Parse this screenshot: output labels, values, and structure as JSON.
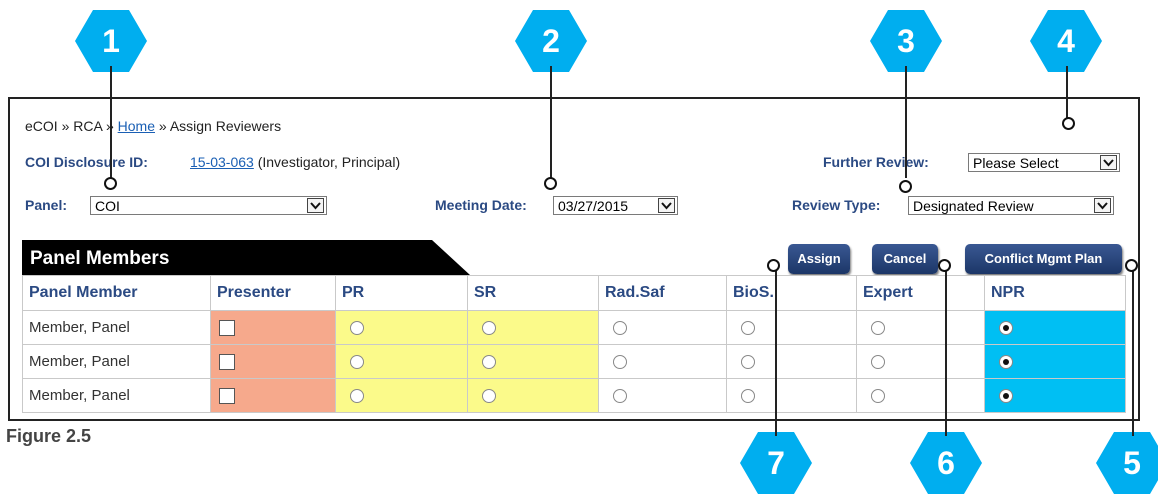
{
  "breadcrumb": {
    "part1": "eCOI",
    "sep": "»",
    "part2": "RCA",
    "home": "Home",
    "current": "Assign Reviewers"
  },
  "disclosure": {
    "label": "COI Disclosure ID:",
    "id": "15-03-063",
    "role": "(Investigator, Principal)"
  },
  "further_review": {
    "label": "Further Review:",
    "value": "Please Select"
  },
  "panel": {
    "label": "Panel:",
    "value": "COI"
  },
  "meeting_date": {
    "label": "Meeting Date:",
    "value": "03/27/2015"
  },
  "review_type": {
    "label": "Review Type:",
    "value": "Designated Review"
  },
  "section_title": "Panel Members",
  "buttons": {
    "assign": "Assign",
    "cancel": "Cancel",
    "conflict_plan": "Conflict Mgmt Plan"
  },
  "table": {
    "columns": [
      "Panel Member",
      "Presenter",
      "PR",
      "SR",
      "Rad.Saf",
      "BioS.",
      "Expert",
      "NPR"
    ],
    "rows": [
      {
        "member": "Member, Panel",
        "presenter": false,
        "selected": "NPR"
      },
      {
        "member": "Member, Panel",
        "presenter": false,
        "selected": "NPR"
      },
      {
        "member": "Member, Panel",
        "presenter": false,
        "selected": "NPR"
      }
    ]
  },
  "callouts": [
    "1",
    "2",
    "3",
    "4",
    "5",
    "6",
    "7"
  ],
  "caption": "Figure 2.5",
  "colors": {
    "callout": "#00aeef",
    "presenter_col": "#f6a98c",
    "review_col": "#fbfa8a",
    "npr_col": "#00bff3",
    "header_text": "#2b4a83"
  }
}
